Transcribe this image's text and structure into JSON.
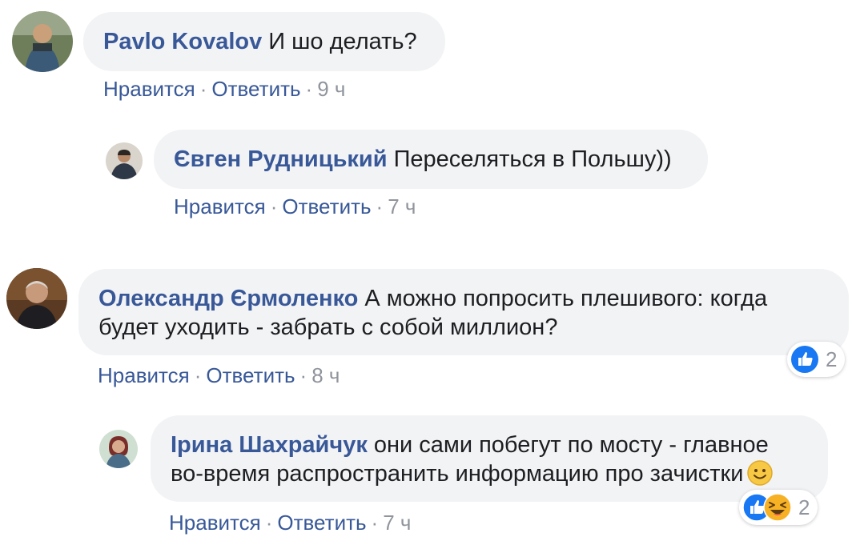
{
  "comments": [
    {
      "author": "Pavlo Kovalov",
      "text": "И шо делать?",
      "actions": {
        "like": "Нравится",
        "reply": "Ответить",
        "time": "9 ч"
      }
    },
    {
      "author": "Євген Рудницький",
      "text": "Переселяться в Польшу))",
      "actions": {
        "like": "Нравится",
        "reply": "Ответить",
        "time": "7 ч"
      }
    },
    {
      "author": "Олександр Єрмоленко",
      "text_line1": "А можно попросить плешивого: когда",
      "text_line2": "будет уходить - забрать с собой миллион?",
      "actions": {
        "like": "Нравится",
        "reply": "Ответить",
        "time": "8 ч"
      },
      "reactions": {
        "count": "2",
        "icons": [
          "like-icon"
        ]
      }
    },
    {
      "author": "Ірина Шахрайчук",
      "text_line1": "они сами побегут по мосту - главное",
      "text_line2": "во-время распространить информацию про зачистки",
      "text_emoji": "smiley-emoji-icon",
      "actions": {
        "like": "Нравится",
        "reply": "Ответить",
        "time": "7 ч"
      },
      "reactions": {
        "count": "2",
        "icons": [
          "like-icon",
          "haha-icon"
        ]
      }
    }
  ],
  "separator": "·",
  "colors": {
    "link": "#385898",
    "meta": "#90949c",
    "bubble": "#f2f3f5",
    "like": "#1877f2",
    "haha": "#f7b125"
  }
}
